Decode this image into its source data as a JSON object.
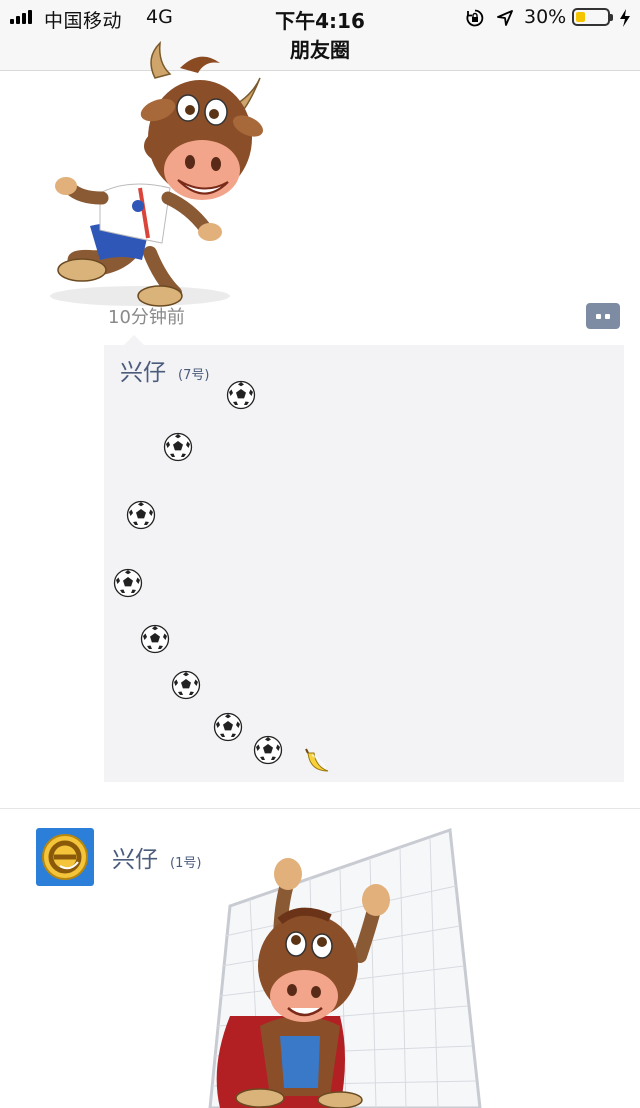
{
  "status_bar": {
    "carrier": "中国移动",
    "network": "4G",
    "time": "下午4:16",
    "battery_percent": "30%",
    "battery_level": 0.3,
    "battery_color": "#f5c400",
    "icons": [
      "signal-bars-icon",
      "orientation-lock-icon",
      "location-arrow-icon",
      "battery-icon",
      "charging-bolt-icon"
    ]
  },
  "nav": {
    "title": "朋友圈"
  },
  "post1": {
    "image": "cartoon-bull-mascot",
    "timestamp": "10分钟前",
    "comment_button_icon": "comment-dots-icon",
    "comment": {
      "author": "兴仔",
      "author_note": "(7号)",
      "emoji": [
        "soccer-ball",
        "soccer-ball",
        "soccer-ball",
        "soccer-ball",
        "soccer-ball",
        "soccer-ball",
        "soccer-ball",
        "soccer-ball",
        "banana"
      ]
    }
  },
  "post2": {
    "avatar": "brand-logo-avatar",
    "author": "兴仔",
    "author_note": "(1号)",
    "image": "bull-mascot-goalkeeper"
  },
  "colors": {
    "name_link": "#4a5b7c",
    "comment_bg": "#f3f3f5",
    "comment_button": "#7d8ba3",
    "timestamp": "#8a8a8a"
  }
}
